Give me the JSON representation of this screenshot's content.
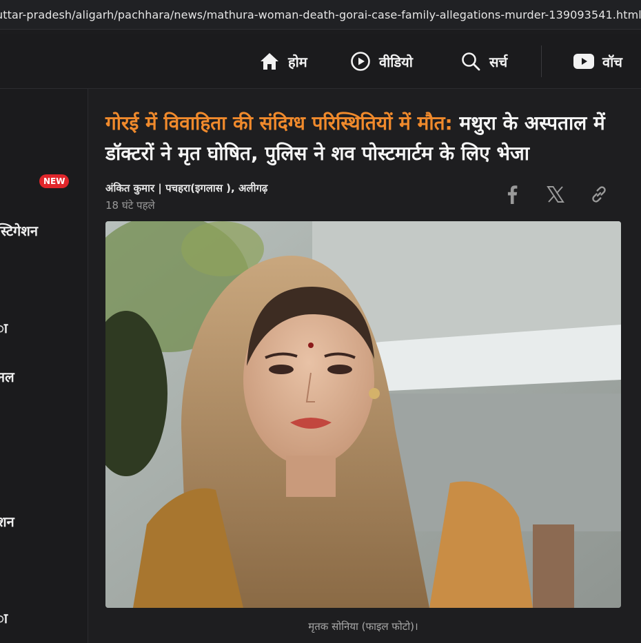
{
  "browser": {
    "url": "uttar-pradesh/aligarh/pachhara/news/mathura-woman-death-gorai-case-family-allegations-murder-139093541.html"
  },
  "nav": {
    "home": "होम",
    "video": "वीडियो",
    "search": "सर्च",
    "watch": "वॉच"
  },
  "sidebar": {
    "badge": "NEW",
    "items": [
      "स्टिगेशन",
      "ा",
      "नल",
      "शन",
      "ा"
    ]
  },
  "article": {
    "headline_accent": "गोरई में विवाहिता की संदिग्ध परिस्थितियों में मौत:",
    "headline_rest": " मथुरा के अस्पताल में डॉक्टरों ने मृत घोषित, पुलिस ने शव पोस्टमार्टम के लिए भेजा",
    "byline": "अंकित कुमार | पचहरा(इगलास ), अलीगढ़",
    "timestamp": "18 घंटे पहले",
    "caption": "मृतक सोनिया (फाइल फोटो)।"
  },
  "colors": {
    "accent": "#f08a2c",
    "badge": "#e0262b",
    "background": "#1c1c1e"
  },
  "icons": {
    "home": "home-icon",
    "video": "play-circle-icon",
    "search": "search-icon",
    "watch": "youtube-icon",
    "facebook": "facebook-icon",
    "x": "x-icon",
    "link": "link-icon"
  }
}
